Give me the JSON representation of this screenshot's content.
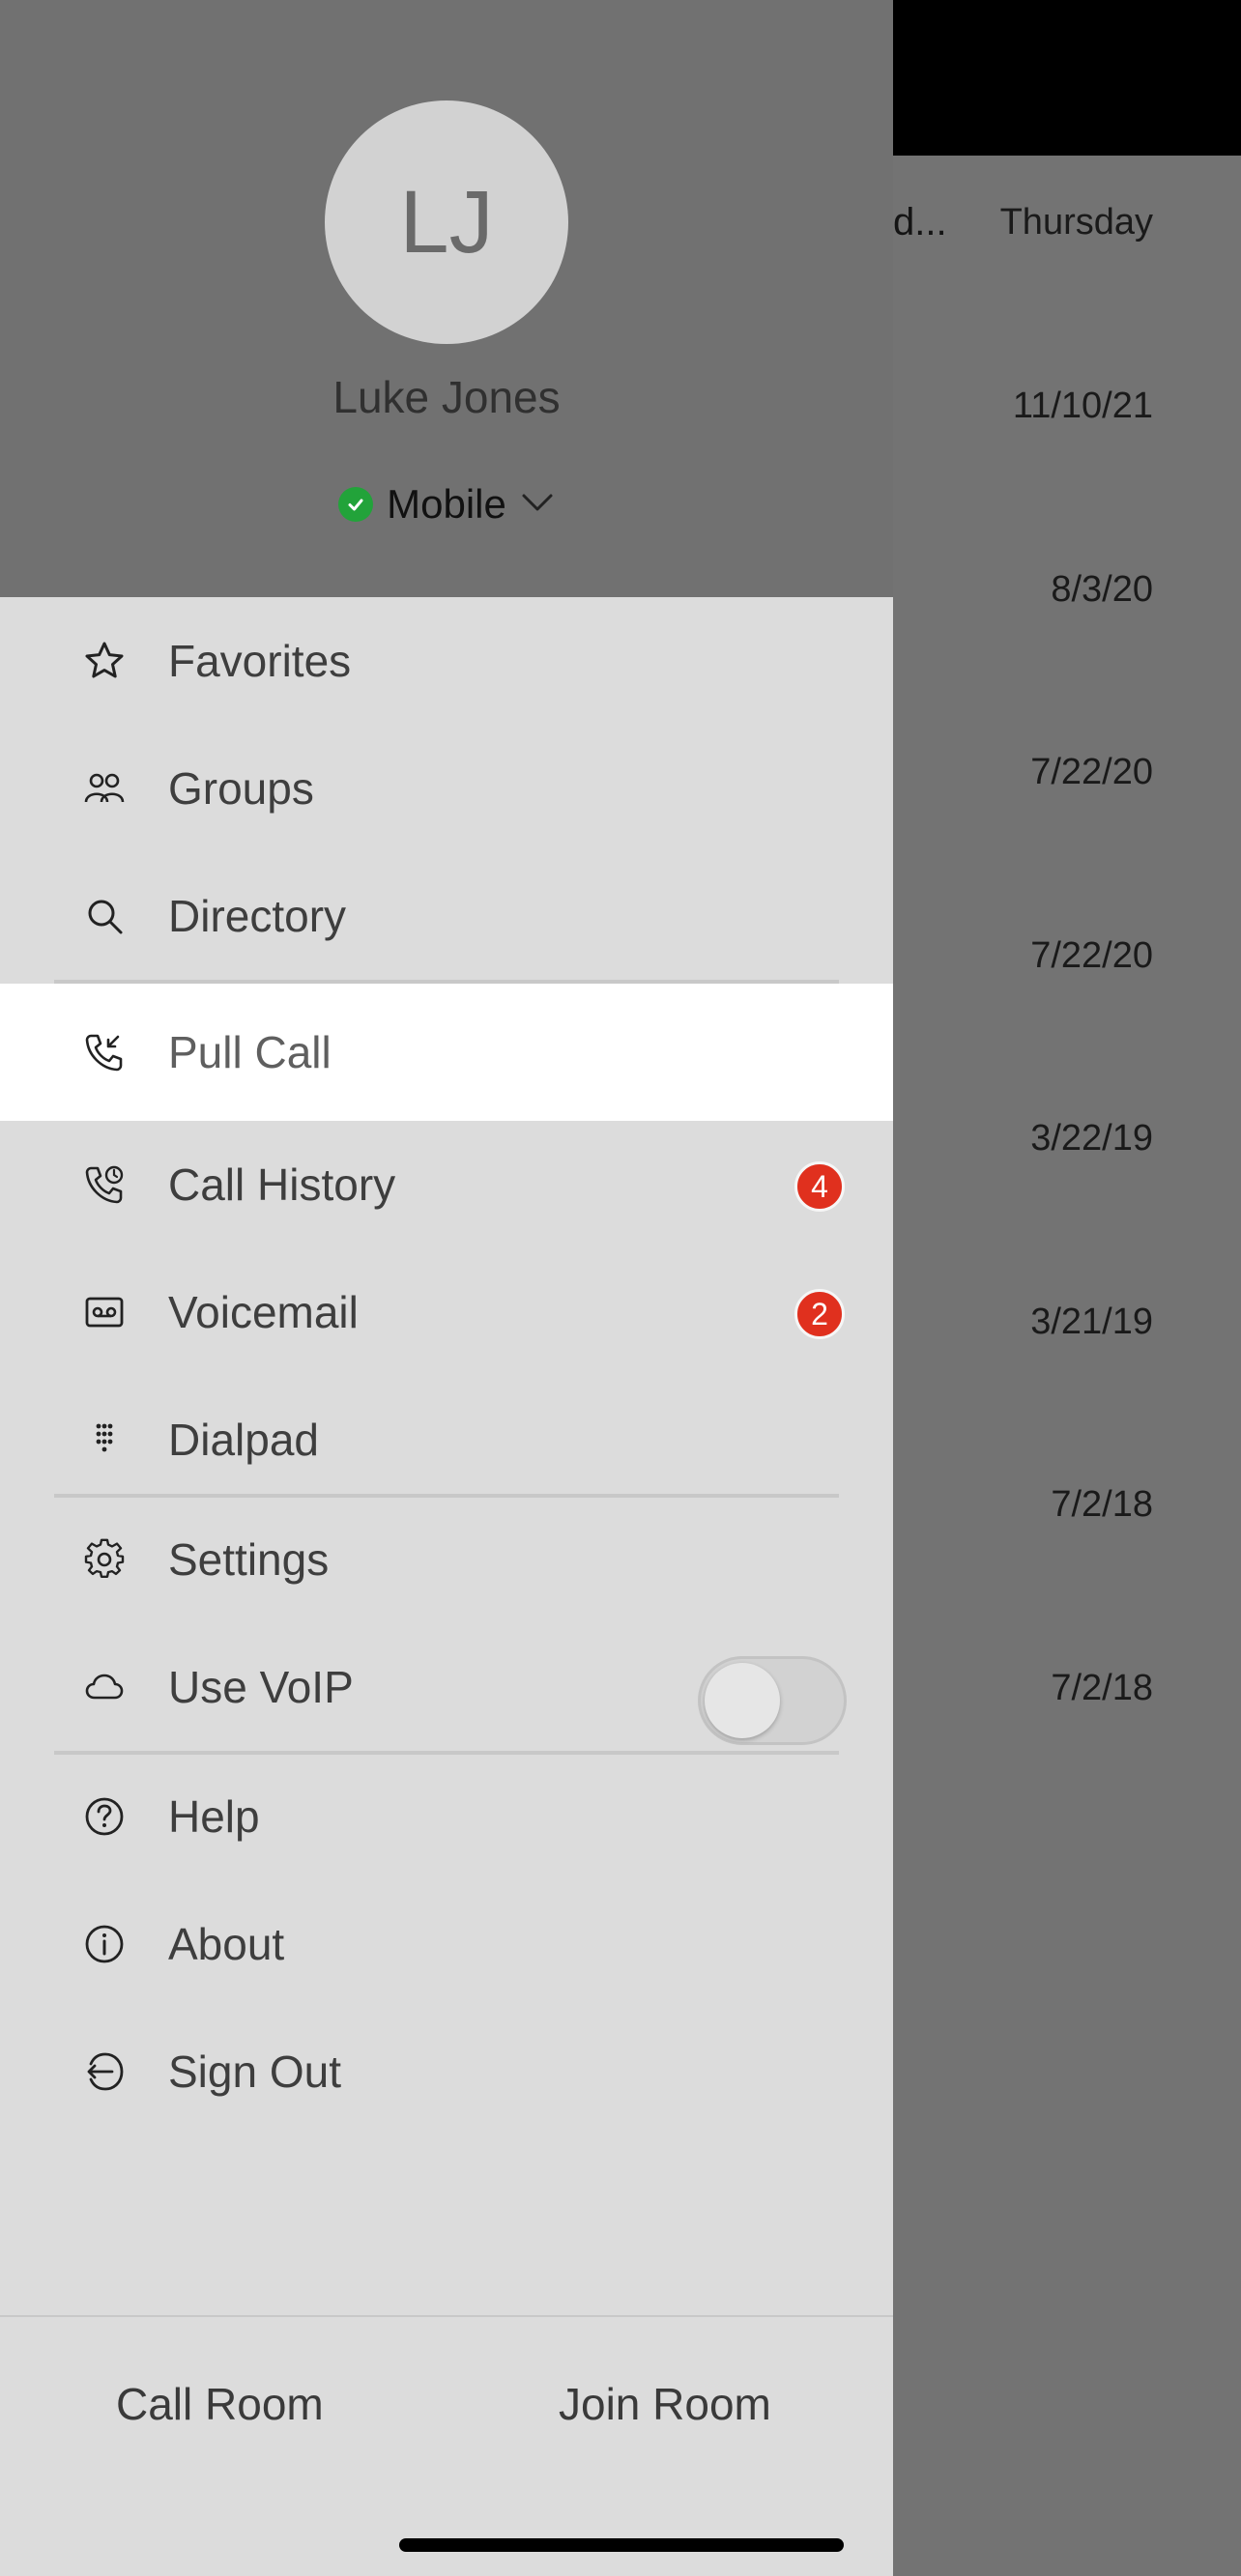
{
  "background_list": {
    "truncated_text": "d...",
    "dates": [
      "Thursday",
      "11/10/21",
      "8/3/20",
      "7/22/20",
      "7/22/20",
      "3/22/19",
      "3/21/19",
      "7/2/18",
      "7/2/18"
    ],
    "add_icon": "plus-icon"
  },
  "profile": {
    "initials": "LJ",
    "name": "Luke Jones",
    "status_label": "Mobile",
    "status_color": "#22a33a"
  },
  "menu": {
    "favorites": "Favorites",
    "groups": "Groups",
    "directory": "Directory",
    "pull_call": "Pull Call",
    "call_history": "Call History",
    "call_history_badge": "4",
    "voicemail": "Voicemail",
    "voicemail_badge": "2",
    "dialpad": "Dialpad",
    "settings": "Settings",
    "use_voip": "Use VoIP",
    "use_voip_enabled": false,
    "help": "Help",
    "about": "About",
    "sign_out": "Sign Out"
  },
  "bottom": {
    "call_room": "Call Room",
    "join_room": "Join Room"
  },
  "colors": {
    "badge": "#e0301e",
    "selected_row": "#ffffff",
    "drawer_bg": "#dcdcdc"
  }
}
